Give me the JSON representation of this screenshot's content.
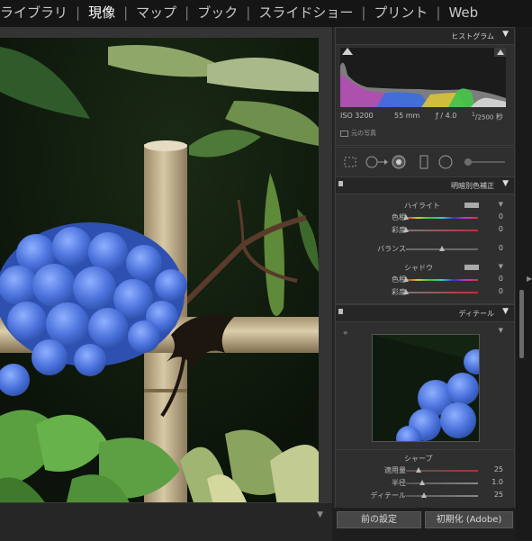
{
  "nav": {
    "items": [
      "ライブラリ",
      "現像",
      "マップ",
      "ブック",
      "スライドショー",
      "プリント",
      "Web"
    ],
    "active_index": 1
  },
  "histogram": {
    "title": "ヒストグラム",
    "exif": {
      "iso": "ISO 3200",
      "focal": "55 mm",
      "aperture": "ƒ / 4.0",
      "shutter_num": "1",
      "shutter_den": "2500",
      "shutter_unit": "秒"
    },
    "original_label": "元の写真"
  },
  "split_toning": {
    "title": "明暗別色補正",
    "highlights": {
      "label": "ハイライト",
      "hue_label": "色相",
      "hue": "0",
      "sat_label": "彩度",
      "sat": "0"
    },
    "balance": {
      "label": "バランス",
      "value": "0",
      "position": 0.5
    },
    "shadows": {
      "label": "シャドウ",
      "hue_label": "色相",
      "hue": "0",
      "sat_label": "彩度",
      "sat": "0"
    }
  },
  "detail": {
    "title": "ディテール",
    "sharpen": {
      "label": "シャープ",
      "amount": {
        "label": "適用量",
        "value": "25",
        "position": 0.17
      },
      "radius": {
        "label": "半径",
        "value": "1.0",
        "position": 0.22
      },
      "detail": {
        "label": "ディテール",
        "value": "25",
        "position": 0.25
      }
    }
  },
  "buttons": {
    "previous": "前の設定",
    "reset": "初期化 (Adobe)"
  },
  "colors": {
    "panel_bg": "#292929",
    "section_bg": "#2f2f2f",
    "hydrangea": "#4a73d8",
    "bamboo": "#c6b491"
  }
}
